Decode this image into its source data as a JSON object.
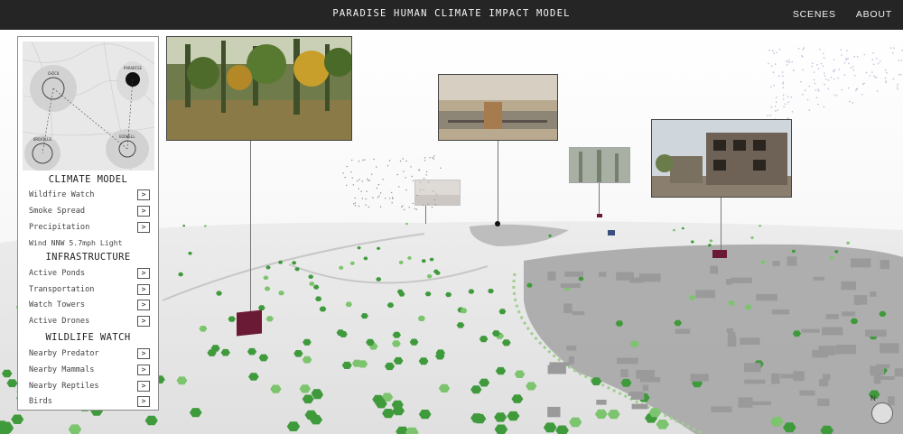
{
  "header": {
    "title": "PARADISE HUMAN CLIMATE IMPACT MODEL",
    "nav": [
      {
        "label": "SCENES"
      },
      {
        "label": "ABOUT"
      }
    ]
  },
  "minimap": {
    "labels": [
      "CHICO",
      "PARADISE",
      "OROVILLE",
      "BIDWELL"
    ]
  },
  "panel": {
    "sections": [
      {
        "title": "CLIMATE MODEL",
        "items": [
          {
            "label": "Wildfire Watch",
            "button": ">"
          },
          {
            "label": "Smoke Spread",
            "button": ">"
          },
          {
            "label": "Precipitation",
            "button": ">"
          }
        ],
        "note": "Wind NNW 5.7mph Light"
      },
      {
        "title": "INFRASTRUCTURE",
        "items": [
          {
            "label": "Active Ponds",
            "button": ">"
          },
          {
            "label": "Transportation",
            "button": ">"
          },
          {
            "label": "Watch Towers",
            "button": ">"
          },
          {
            "label": "Active Drones",
            "button": ">"
          }
        ]
      },
      {
        "title": "WILDLIFE WATCH",
        "items": [
          {
            "label": "Nearby Predator",
            "button": ">"
          },
          {
            "label": "Nearby Mammals",
            "button": ">"
          },
          {
            "label": "Nearby Reptiles",
            "button": ">"
          },
          {
            "label": "Birds",
            "button": ">"
          }
        ]
      }
    ]
  },
  "scene": {
    "compass_label": "N",
    "colors": {
      "ground": "#e4e4e4",
      "tree": "#3f9a3c",
      "tree_light": "#7cc46e",
      "building": "#9a9a9a",
      "marker": "#6b1a35",
      "header_bg": "#252525"
    }
  }
}
